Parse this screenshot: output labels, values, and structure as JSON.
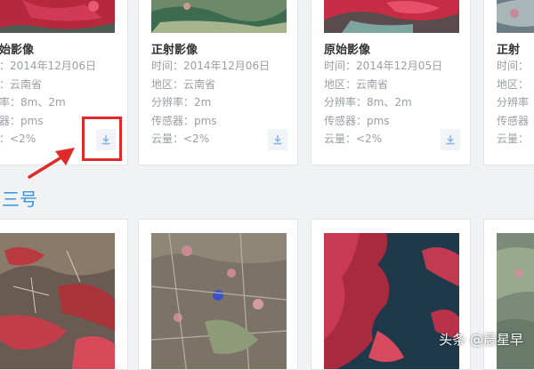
{
  "cards": [
    {
      "title": "始影像",
      "time": "：2014年12月06日",
      "region": "：云南省",
      "resolution": "率：8m、2m",
      "sensor": "器：pms",
      "cloud": "：<2%"
    },
    {
      "title": "正射影像",
      "time": "时间：2014年12月06日",
      "region": "地区：云南省",
      "resolution": "分辨率：2m",
      "sensor": "传感器：pms",
      "cloud": "云量：<2%"
    },
    {
      "title": "原始影像",
      "time": "时间：2014年12月05日",
      "region": "地区：云南省",
      "resolution": "分辨率：8m、2m",
      "sensor": "传感器：pms",
      "cloud": "云量：<2%"
    },
    {
      "title": "正射",
      "time": "时间：",
      "region": "地区：",
      "resolution": "分辨率",
      "sensor": "传感器",
      "cloud": "云量："
    }
  ],
  "section": {
    "title": "三号"
  },
  "watermark": "头条 @晨星早",
  "colors": {
    "accent": "#3a93dd",
    "highlight": "#e02a2a",
    "download_icon": "#7fb3e3"
  },
  "icons": {
    "download": "download-icon",
    "arrow": "red-arrow-icon"
  }
}
